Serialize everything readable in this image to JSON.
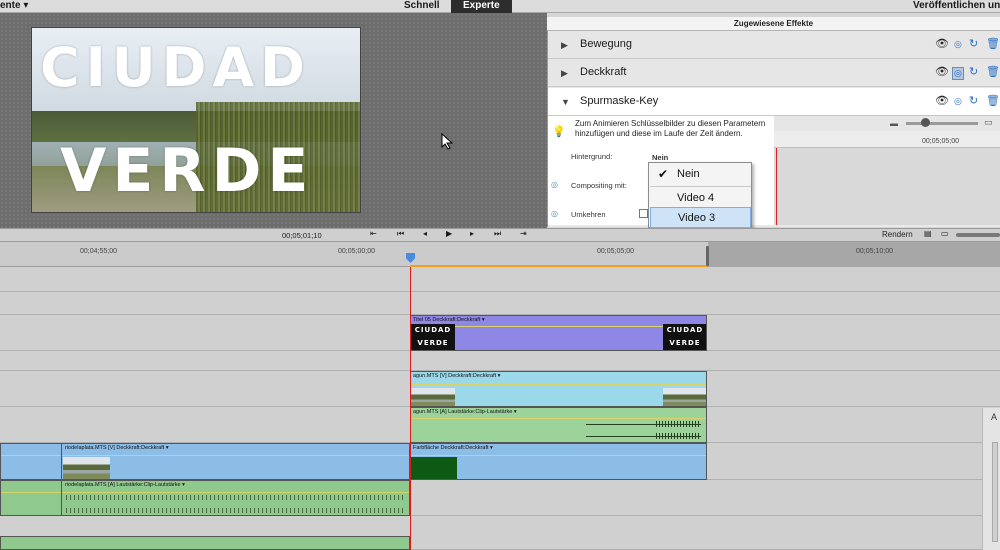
{
  "topbar": {
    "left_menu": "ente",
    "tab_quick": "Schnell",
    "tab_expert": "Experte",
    "right_menu": "Veröffentlichen und F"
  },
  "preview": {
    "line1": "CIUDAD",
    "line2": "VERDE"
  },
  "effects": {
    "title": "Zugewiesene Effekte",
    "rows": [
      {
        "label": "Bewegung"
      },
      {
        "label": "Deckkraft"
      },
      {
        "label": "Spurmaske-Key"
      }
    ],
    "info": "Zum Animieren Schlüsselbilder zu diesen Parametern hinzufügen und diese im Laufe der Zeit ändern.",
    "param_background_label": "Hintergrund:",
    "param_background_value": "Nein",
    "param_compositing_label": "Compositing mit:",
    "param_invert_label": "Umkehren",
    "keyframe_time": "00;05;05;00"
  },
  "dropdown": {
    "options": [
      "Nein",
      "Video 4",
      "Video 3"
    ],
    "checked": "Nein",
    "highlighted": "Video 3"
  },
  "transport": {
    "timecode": "00;05;01;10",
    "render_label": "Rendern"
  },
  "ruler": {
    "ticks": [
      "00;04;55;00",
      "00;05;00;00",
      "00;05;05;00",
      "00;05;10;00"
    ]
  },
  "clips": {
    "title_clip": "Titel 05  Deckkraft:Deckkraft ▾",
    "title_thumb_1": "CIUDAD",
    "title_thumb_2": "VERDE",
    "lagun_v": "agun.MTS [V]  Deckkraft:Deckkraft ▾",
    "lagun_a": "agun.MTS [A]  Lautstärke:Clip-Lautstärke ▾",
    "rio_v": "riodelaplata.MTS [V]  Deckkraft:Deckkraft ▾",
    "rio_a": "riodelaplata.MTS [A]  Lautstärke:Clip-Lautstärke ▾",
    "farbflaeche": "Farbfläche  Deckkraft:Deckkraft ▾"
  },
  "side_panel": {
    "tab_letter": "A"
  }
}
